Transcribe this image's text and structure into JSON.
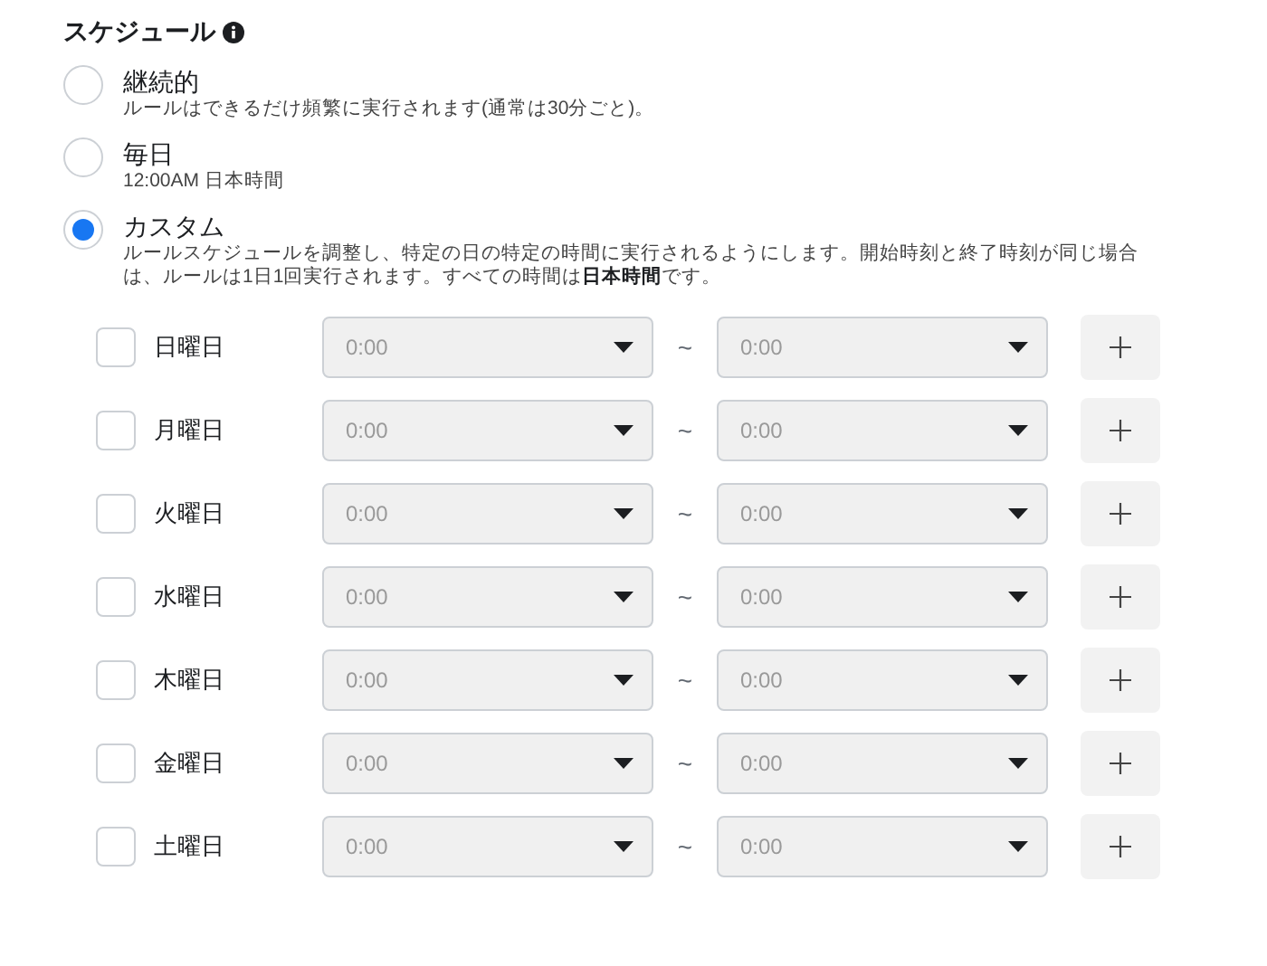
{
  "title": "スケジュール",
  "options": [
    {
      "label": "継続的",
      "description": "ルールはできるだけ頻繁に実行されます(通常は30分ごと)。",
      "selected": false
    },
    {
      "label": "毎日",
      "description": "12:00AM 日本時間",
      "selected": false
    },
    {
      "label": "カスタム",
      "description": "ルールスケジュールを調整し、特定の日の特定の時間に実行されるようにします。開始時刻と終了時刻が同じ場合は、ルールは1日1回実行されます。すべての時間は**日本時間**です。",
      "selected": true
    }
  ],
  "days": [
    {
      "label": "日曜日",
      "checked": false,
      "start": "0:00",
      "separator": "~",
      "end": "0:00"
    },
    {
      "label": "月曜日",
      "checked": false,
      "start": "0:00",
      "separator": "~",
      "end": "0:00"
    },
    {
      "label": "火曜日",
      "checked": false,
      "start": "0:00",
      "separator": "~",
      "end": "0:00"
    },
    {
      "label": "水曜日",
      "checked": false,
      "start": "0:00",
      "separator": "~",
      "end": "0:00"
    },
    {
      "label": "木曜日",
      "checked": false,
      "start": "0:00",
      "separator": "~",
      "end": "0:00"
    },
    {
      "label": "金曜日",
      "checked": false,
      "start": "0:00",
      "separator": "~",
      "end": "0:00"
    },
    {
      "label": "土曜日",
      "checked": false,
      "start": "0:00",
      "separator": "~",
      "end": "0:00"
    }
  ]
}
